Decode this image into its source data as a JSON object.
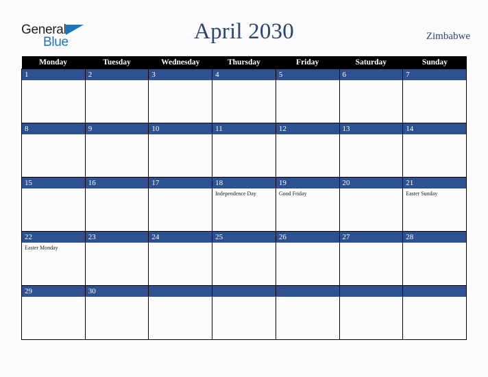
{
  "brand": {
    "name_part1": "General",
    "name_part2": "Blue",
    "color_dark": "#231F20",
    "color_blue": "#1B75BC"
  },
  "header": {
    "title": "April 2030",
    "country": "Zimbabwe",
    "title_color": "#2B4570"
  },
  "calendar": {
    "weekday_headers": [
      "Monday",
      "Tuesday",
      "Wednesday",
      "Thursday",
      "Friday",
      "Saturday",
      "Sunday"
    ],
    "header_bg": "#000000",
    "day_band_bg": "#2E5191",
    "cell_bg": "#FCFCFD",
    "weeks": [
      [
        {
          "day": "1",
          "events": []
        },
        {
          "day": "2",
          "events": []
        },
        {
          "day": "3",
          "events": []
        },
        {
          "day": "4",
          "events": []
        },
        {
          "day": "5",
          "events": []
        },
        {
          "day": "6",
          "events": []
        },
        {
          "day": "7",
          "events": []
        }
      ],
      [
        {
          "day": "8",
          "events": []
        },
        {
          "day": "9",
          "events": []
        },
        {
          "day": "10",
          "events": []
        },
        {
          "day": "11",
          "events": []
        },
        {
          "day": "12",
          "events": []
        },
        {
          "day": "13",
          "events": []
        },
        {
          "day": "14",
          "events": []
        }
      ],
      [
        {
          "day": "15",
          "events": []
        },
        {
          "day": "16",
          "events": []
        },
        {
          "day": "17",
          "events": []
        },
        {
          "day": "18",
          "events": [
            "Independence Day"
          ]
        },
        {
          "day": "19",
          "events": [
            "Good Friday"
          ]
        },
        {
          "day": "20",
          "events": []
        },
        {
          "day": "21",
          "events": [
            "Easter Sunday"
          ]
        }
      ],
      [
        {
          "day": "22",
          "events": [
            "Easter Monday"
          ]
        },
        {
          "day": "23",
          "events": []
        },
        {
          "day": "24",
          "events": []
        },
        {
          "day": "25",
          "events": []
        },
        {
          "day": "26",
          "events": []
        },
        {
          "day": "27",
          "events": []
        },
        {
          "day": "28",
          "events": []
        }
      ],
      [
        {
          "day": "29",
          "events": []
        },
        {
          "day": "30",
          "events": []
        },
        {
          "day": "",
          "events": []
        },
        {
          "day": "",
          "events": []
        },
        {
          "day": "",
          "events": []
        },
        {
          "day": "",
          "events": []
        },
        {
          "day": "",
          "events": []
        }
      ]
    ]
  }
}
